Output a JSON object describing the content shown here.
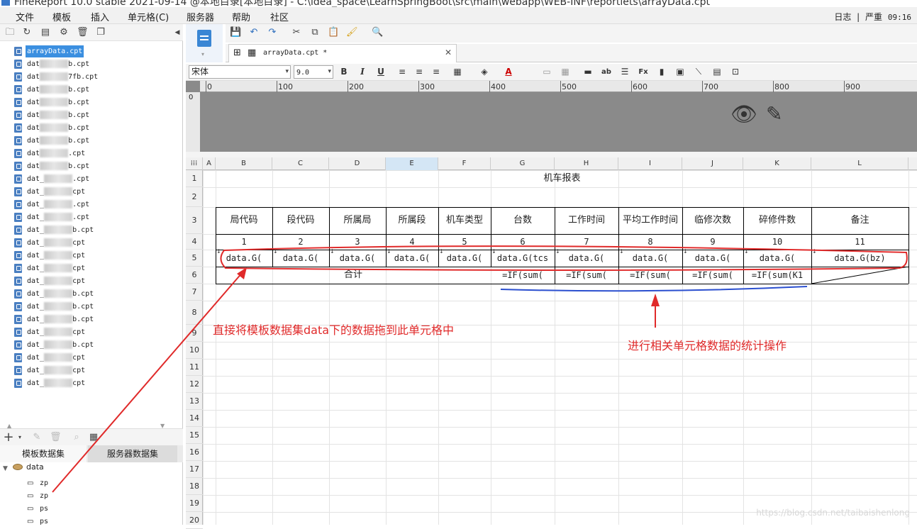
{
  "window": {
    "title": "FineReport 10.0 stable 2021-09-14 @本地目录[本地目录] - C:\\idea_space\\LearnSpringBoot\\src\\main\\webapp\\WEB-INF\\reportlets\\arrayData.cpt"
  },
  "menu": [
    "文件",
    "模板",
    "插入",
    "单元格(C)",
    "服务器",
    "帮助",
    "社区"
  ],
  "status": {
    "log": "日志",
    "severity": "严重",
    "time": "09:16"
  },
  "files": {
    "selected": "arrayData.cpt",
    "items": [
      "dat",
      "dat",
      "dat",
      "dat",
      "dat",
      "dat",
      "dat",
      "dat",
      "dat",
      "dat_",
      "dat_",
      "dat_",
      "dat_",
      "dat_",
      "dat_",
      "dat_",
      "dat_",
      "dat_",
      "dat_",
      "dat_",
      "dat_",
      "dat_",
      "dat_",
      "dat_",
      "dat_",
      "dat_"
    ],
    "suffixes": [
      "b.cpt",
      "7fb.cpt",
      "b.cpt",
      "b.cpt",
      "b.cpt",
      "b.cpt",
      "b.cpt",
      ".cpt",
      "b.cpt",
      ".cpt",
      "cpt",
      ".cpt",
      ".cpt",
      "b.cpt",
      "cpt",
      "cpt",
      "cpt",
      "cpt",
      "b.cpt",
      "b.cpt",
      "b.cpt",
      "cpt",
      "b.cpt",
      "cpt",
      "cpt",
      "cpt"
    ]
  },
  "datasets": {
    "tab_template": "模板数据集",
    "tab_server": "服务器数据集",
    "root": "data",
    "fields": [
      "zp",
      "zp",
      "ps",
      "ps"
    ]
  },
  "editor": {
    "tab": "arrayData.cpt *",
    "font": "宋体",
    "size": "9.0"
  },
  "ruler": [
    "0",
    "100",
    "200",
    "300",
    "400",
    "500",
    "600",
    "700",
    "800",
    "900"
  ],
  "columns": [
    "A",
    "B",
    "C",
    "D",
    "E",
    "F",
    "G",
    "H",
    "I",
    "J",
    "K",
    "L"
  ],
  "rows": [
    "1",
    "2",
    "3",
    "4",
    "5",
    "6",
    "7",
    "8",
    "9",
    "10",
    "11",
    "12",
    "13",
    "14",
    "15",
    "16",
    "17",
    "18",
    "19",
    "20"
  ],
  "report": {
    "title": "机车报表",
    "headers": [
      "局代码",
      "段代码",
      "所属局",
      "所属段",
      "机车类型",
      "台数",
      "工作时间",
      "平均工作时间",
      "临修次数",
      "碎修件数",
      "备注"
    ],
    "numbers": [
      "1",
      "2",
      "3",
      "4",
      "5",
      "6",
      "7",
      "8",
      "9",
      "10",
      "11"
    ],
    "data_row": [
      "data.G(",
      "data.G(",
      "data.G(",
      "data.G(",
      "data.G(",
      "data.G(tcs",
      "data.G(",
      "data.G(",
      "data.G(",
      "data.G(",
      "data.G(bz)"
    ],
    "total_label": "合计",
    "sums": [
      "=IF(sum(",
      "=IF(sum(",
      "=IF(sum(",
      "=IF(sum(",
      "=IF(sum(K1"
    ]
  },
  "annotations": {
    "drag": "直接将模板数据集data下的数据拖到此单元格中",
    "stats": "进行相关单元格数据的统计操作"
  },
  "watermark": "https://blog.csdn.net/taibaishenlong"
}
